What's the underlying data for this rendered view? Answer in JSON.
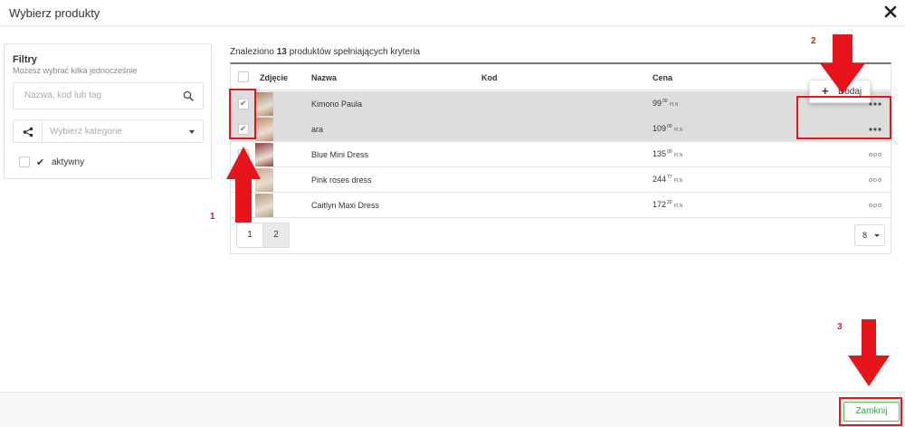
{
  "modal": {
    "title": "Wybierz produkty",
    "close_icon": "close-x-icon"
  },
  "filters": {
    "title": "Filtry",
    "subtitle": "Możesz wybrać kilka jednocześnie",
    "search_placeholder": "Nazwa, kod lub tag",
    "category_placeholder": "Wybierz kategorie",
    "active_label": "aktywny"
  },
  "results": {
    "found_prefix": "Znaleziono",
    "found_count": "13",
    "found_suffix": "produktów spełniających kryteria",
    "columns": {
      "photo": "Zdjęcie",
      "name": "Nazwa",
      "code": "Kod",
      "price": "Cena"
    },
    "rows": [
      {
        "name": "Kimono Paula",
        "code": "",
        "price_int": "99",
        "price_dec": "00",
        "currency": "PLN",
        "selected": true,
        "thumb_color": "#a58a6a"
      },
      {
        "name": "ara",
        "code": "",
        "price_int": "109",
        "price_dec": "00",
        "currency": "PLN",
        "selected": true,
        "thumb_color": "#c58a6e"
      },
      {
        "name": "Blue Mini Dress",
        "code": "",
        "price_int": "135",
        "price_dec": "00",
        "currency": "PLN",
        "selected": false,
        "thumb_color": "#8a3e3e"
      },
      {
        "name": "Pink roses dress",
        "code": "",
        "price_int": "244",
        "price_dec": "77",
        "currency": "PLN",
        "selected": false,
        "thumb_color": "#c9a890"
      },
      {
        "name": "Caitlyn Maxi Dress",
        "code": "",
        "price_int": "172",
        "price_dec": "20",
        "currency": "PLN",
        "selected": false,
        "thumb_color": "#b59a80"
      }
    ],
    "pages": [
      "1",
      "2"
    ],
    "active_page": "2",
    "per_page": "8"
  },
  "popover": {
    "label": "Dodaj"
  },
  "footer": {
    "close_label": "Zamknij"
  },
  "annotations": {
    "label_1": "1",
    "label_2": "2",
    "label_3": "3",
    "color": "#e8141c"
  },
  "colors": {
    "selected_row": "#dddddd",
    "close_button_accent": "#5cb85c"
  }
}
